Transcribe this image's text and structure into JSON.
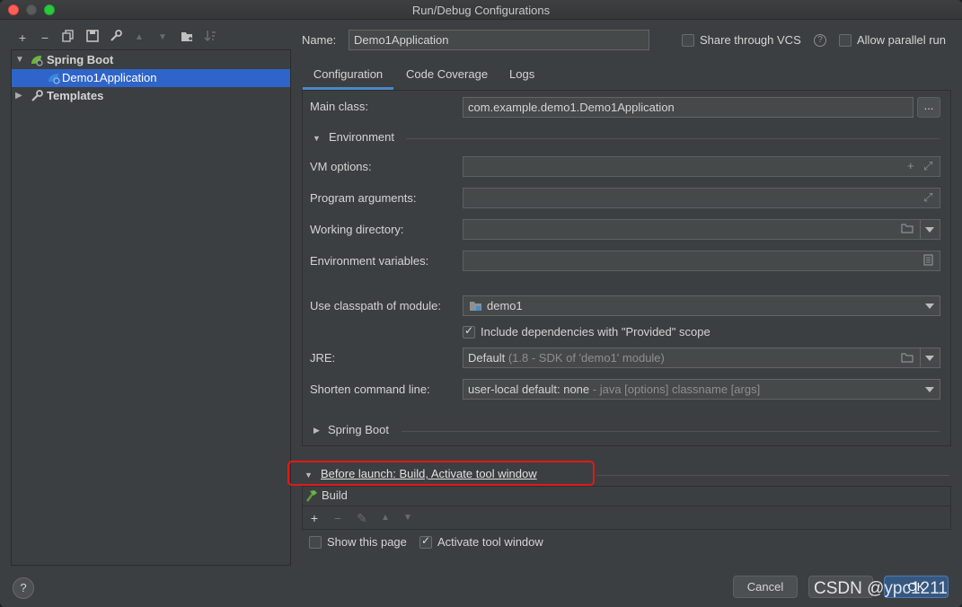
{
  "window": {
    "title": "Run/Debug Configurations"
  },
  "tree": {
    "items": [
      {
        "label": "Spring Boot",
        "expanded": true
      },
      {
        "label": "Demo1Application",
        "selected": true
      },
      {
        "label": "Templates",
        "expanded": false
      }
    ]
  },
  "header": {
    "name_label": "Name:",
    "name_value": "Demo1Application",
    "share_vcs_label": "Share through VCS",
    "allow_parallel_label": "Allow parallel run"
  },
  "tabs": [
    {
      "label": "Configuration",
      "active": true
    },
    {
      "label": "Code Coverage"
    },
    {
      "label": "Logs"
    }
  ],
  "config": {
    "main_class_label": "Main class:",
    "main_class_value": "com.example.demo1.Demo1Application",
    "browse_label": "...",
    "environment_title": "Environment",
    "vm_options_label": "VM options:",
    "program_args_label": "Program arguments:",
    "working_dir_label": "Working directory:",
    "env_vars_label": "Environment variables:",
    "classpath_label": "Use classpath of module:",
    "classpath_value": "demo1",
    "include_deps_label": "Include dependencies with \"Provided\" scope",
    "jre_label": "JRE:",
    "jre_value": "Default",
    "jre_hint": "(1.8 - SDK of 'demo1' module)",
    "shorten_label": "Shorten command line:",
    "shorten_value": "user-local default: none",
    "shorten_hint": "- java [options] classname [args]",
    "spring_boot_title": "Spring Boot"
  },
  "before_launch": {
    "title": "Before launch: Build, Activate tool window",
    "items": [
      {
        "label": "Build"
      }
    ]
  },
  "footer": {
    "show_page_label": "Show this page",
    "activate_tool_label": "Activate tool window",
    "help_label": "?",
    "cancel_label": "Cancel",
    "ok_label": "OK"
  },
  "watermark": "CSDN @ypc1211",
  "colors": {
    "selection": "#2f65ca",
    "accent_tab": "#4a88c7",
    "highlight_box": "#e0191b"
  }
}
